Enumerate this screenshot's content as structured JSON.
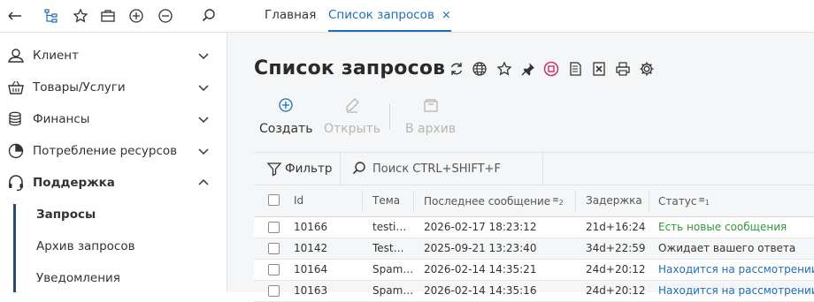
{
  "toolbar": {
    "icons": [
      "back-arrow-icon",
      "hierarchy-icon",
      "star-icon",
      "briefcase-icon",
      "plus-circle-icon",
      "minus-circle-icon",
      "search-icon"
    ]
  },
  "tabs": [
    {
      "label": "Главная"
    },
    {
      "label": "Список запросов",
      "close": "×"
    }
  ],
  "sidebar": {
    "items": [
      {
        "label": "Клиент",
        "icon": "user-icon"
      },
      {
        "label": "Товары/Услуги",
        "icon": "basket-icon"
      },
      {
        "label": "Финансы",
        "icon": "coins-icon"
      },
      {
        "label": "Потребление ресурсов",
        "icon": "pie-chart-icon"
      },
      {
        "label": "Поддержка",
        "icon": "headset-icon"
      }
    ],
    "subitems": [
      {
        "label": "Запросы"
      },
      {
        "label": "Архив запросов"
      },
      {
        "label": "Уведомления"
      }
    ]
  },
  "main": {
    "title": "Список запросов",
    "title_icons": [
      "refresh-icon",
      "globe-icon",
      "star-icon",
      "pin-icon",
      "stop-icon",
      "document-icon",
      "excel-icon",
      "print-icon",
      "settings-icon"
    ],
    "actions": {
      "create": "Создать",
      "edit": "Открыть",
      "archive": "В архив"
    },
    "filter_label": "Фильтр",
    "search_placeholder": "Поиск CTRL+SHIFT+F"
  },
  "table": {
    "columns": {
      "id": "Id",
      "topic": "Тема",
      "last_message": "Последнее сообщение",
      "last_message_sort": "2",
      "delay": "Задержка",
      "status": "Статус",
      "status_sort": "1"
    },
    "rows": [
      {
        "id": "10166",
        "topic": "testi…",
        "last": "2026-02-17 18:23:12",
        "delay": "21d+16:24",
        "status": "Есть новые сообщения",
        "status_color": "#2e9a3a"
      },
      {
        "id": "10142",
        "topic": "Test…",
        "last": "2025-09-21 13:23:40",
        "delay": "34d+22:59",
        "status": "Ожидает вашего ответа",
        "status_color": "#333333"
      },
      {
        "id": "10164",
        "topic": "Spam…",
        "last": "2026-02-14 14:35:21",
        "delay": "24d+20:12",
        "status": "Находится на рассмотрении",
        "status_color": "#1f6fb5"
      },
      {
        "id": "10163",
        "topic": "Spam…",
        "last": "2026-02-14 14:35:16",
        "delay": "24d+20:12",
        "status": "Находится на рассмотрении",
        "status_color": "#1f6fb5"
      }
    ]
  },
  "colors": {
    "accent": "#1f6fb5",
    "status_new": "#2e9a3a",
    "stop_icon": "#d1306b"
  }
}
